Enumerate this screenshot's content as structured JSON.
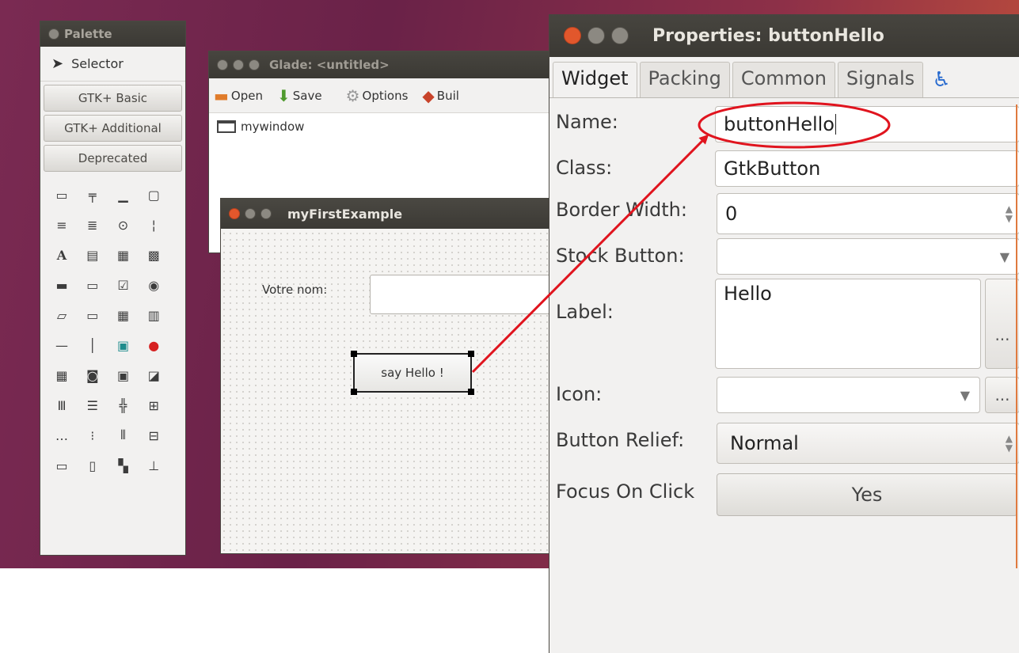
{
  "palette": {
    "title": "Palette",
    "selector_label": "Selector",
    "groups": [
      "GTK+ Basic",
      "GTK+ Additional",
      "Deprecated"
    ],
    "widget_icons": [
      "window-icon",
      "toolbar-icon",
      "label-row-icon",
      "frame-icon",
      "toolbar2-icon",
      "toolbar3-icon",
      "toolbar4-icon",
      "toolbar5-icon",
      "text-label-icon",
      "entry-icon",
      "spin-icon",
      "textview-icon",
      "ok-button-icon",
      "toggle-button-icon",
      "check-button-icon",
      "radio-button-icon",
      "progress-icon",
      "scrollbar-icon",
      "tree-view-icon",
      "icon-view-icon",
      "separator-icon",
      "vseparator-icon",
      "image-icon",
      "color-icon",
      "calendar-icon",
      "drawing-icon",
      "notebook-icon",
      "expander-icon",
      "vbox-icon",
      "hbox-icon",
      "grid-icon",
      "table-icon",
      "hbuttonbox-icon",
      "vbuttonbox-icon",
      "paned-icon",
      "layout-icon",
      "statusbar-icon",
      "menubar-icon",
      "fixed-icon",
      "ruler-icon"
    ]
  },
  "glade": {
    "title": "Glade: <untitled>",
    "toolbar": {
      "open": "Open",
      "save": "Save",
      "options": "Options",
      "build": "Buil"
    },
    "tree_item": "mywindow"
  },
  "example": {
    "title": "myFirstExample",
    "name_label": "Votre nom:",
    "button_label": "say Hello !"
  },
  "properties": {
    "title": "Properties: buttonHello",
    "tabs": [
      "Widget",
      "Packing",
      "Common",
      "Signals"
    ],
    "rows": {
      "name": {
        "label": "Name:",
        "value": "buttonHello"
      },
      "class": {
        "label": "Class:",
        "value": "GtkButton"
      },
      "border_width": {
        "label": "Border Width:",
        "value": "0"
      },
      "stock_button": {
        "label": "Stock Button:",
        "value": ""
      },
      "label": {
        "label": "Label:",
        "value": "Hello"
      },
      "icon": {
        "label": "Icon:",
        "value": ""
      },
      "button_relief": {
        "label": "Button Relief:",
        "value": "Normal"
      },
      "focus_on_click": {
        "label": "Focus On Click",
        "value": "Yes"
      }
    },
    "ellipsis": "..."
  },
  "colors": {
    "annotation": "#e0141e",
    "titlebar": "#3c3b37",
    "close_button": "#e2572c"
  }
}
